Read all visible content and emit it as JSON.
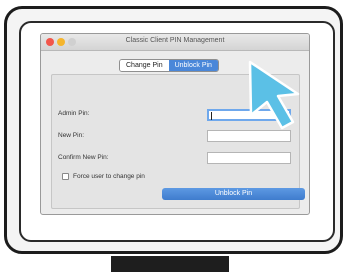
{
  "window": {
    "title": "Classic Client PIN Management"
  },
  "tabs": [
    {
      "label": "Change Pin",
      "selected": false
    },
    {
      "label": "Unblock Pin",
      "selected": true
    }
  ],
  "form": {
    "admin_pin_label": "Admin Pin:",
    "admin_pin_value": "",
    "new_pin_label": "New Pin:",
    "new_pin_value": "",
    "confirm_pin_label": "Confirm New Pin:",
    "confirm_pin_value": "",
    "force_change_label": "Force user to change pin",
    "force_change_checked": false,
    "submit_label": "Unblock Pin"
  },
  "colors": {
    "accent": "#4a87d9",
    "pointer": "#5bc0e6",
    "traffic_close": "#f2564b",
    "traffic_minimize": "#f5b52d"
  },
  "icons": {
    "pointer": "arrow-cursor-icon"
  }
}
